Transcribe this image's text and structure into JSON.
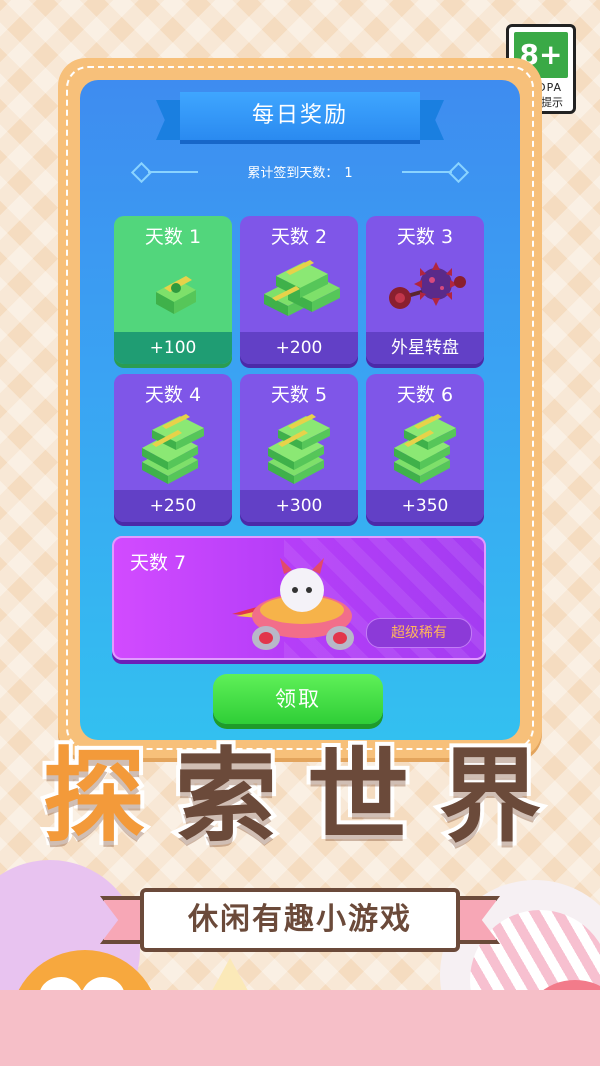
{
  "age_badge": {
    "rating": "8+",
    "org": "CADPA",
    "tip": "适龄提示"
  },
  "panel": {
    "title": "每日奖励",
    "streak_label": "累计签到天数：",
    "streak_value": "1"
  },
  "days": [
    {
      "title": "天数 1",
      "reward": "+100",
      "state": "claimed",
      "icon": "cash-small-icon"
    },
    {
      "title": "天数 2",
      "reward": "+200",
      "state": "locked",
      "icon": "cash-stack-icon"
    },
    {
      "title": "天数 3",
      "reward": "外星转盘",
      "state": "locked",
      "icon": "spiked-mace-icon"
    },
    {
      "title": "天数 4",
      "reward": "+250",
      "state": "locked",
      "icon": "cash-stack-icon"
    },
    {
      "title": "天数 5",
      "reward": "+300",
      "state": "locked",
      "icon": "cash-stack-icon"
    },
    {
      "title": "天数 6",
      "reward": "+350",
      "state": "locked",
      "icon": "cash-stack-icon"
    }
  ],
  "day7": {
    "title": "天数 7",
    "badge": "超级稀有",
    "icon": "cat-spaceship-icon"
  },
  "claim_button": "领取",
  "promo": {
    "title_chars": [
      "探",
      "索",
      "世",
      "界"
    ],
    "subtitle": "休闲有趣小游戏"
  },
  "colors": {
    "claimed_card": "#52d67c",
    "locked_card": "#7f56e8",
    "rare_card": "#c24af8",
    "claim_button": "#3ad43f",
    "title_brown": "#6b4a3a"
  }
}
